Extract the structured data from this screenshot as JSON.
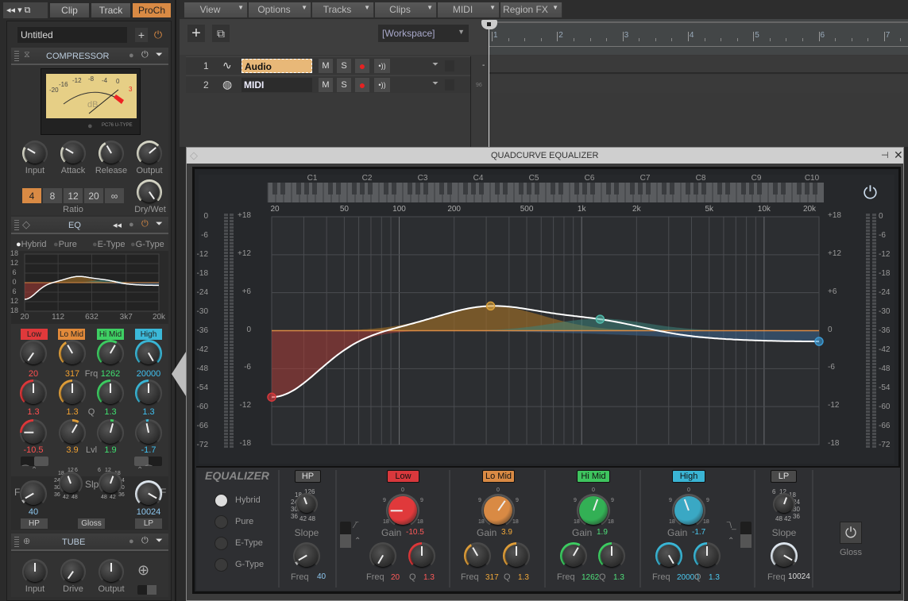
{
  "left_tabs": {
    "clip": "Clip",
    "track": "Track",
    "proch": "ProCh"
  },
  "prochannel": {
    "preset": "Untitled",
    "compressor": {
      "title": "COMPRESSOR",
      "vu_scale": [
        "-20",
        "-16",
        "-12",
        "-8",
        "-4",
        "0",
        "3"
      ],
      "vu_unit": "dB",
      "vu_brand": "PC76 U-TYPE",
      "knobs": [
        "Input",
        "Attack",
        "Release",
        "Output"
      ],
      "ratios": [
        "4",
        "8",
        "12",
        "20",
        "∞"
      ],
      "ratio_selected": "4",
      "ratio_label": "Ratio",
      "drywet_label": "Dry/Wet"
    },
    "eq": {
      "title": "EQ",
      "modes": [
        "Hybrid",
        "Pure",
        "E-Type",
        "G-Type"
      ],
      "selected_mode": "Hybrid",
      "mini_y_labels": [
        "18",
        "12",
        "6",
        "0",
        "6",
        "12",
        "18"
      ],
      "mini_x_labels": [
        "20",
        "112",
        "632",
        "3k7",
        "20k"
      ],
      "bands": [
        {
          "name": "Low",
          "freq": "20",
          "q": "1.3",
          "gain": "-10.5"
        },
        {
          "name": "Lo Mid",
          "freq": "317",
          "q": "1.3",
          "gain": "3.9"
        },
        {
          "name": "Hi Mid",
          "freq": "1262",
          "q": "1.3",
          "gain": "1.9"
        },
        {
          "name": "High",
          "freq": "20000",
          "q": "1.3",
          "gain": "-1.7"
        }
      ],
      "row_labels": {
        "freq": "Frq",
        "q": "Q",
        "lvl": "Lvl"
      },
      "slope_label": "Slp",
      "slope_ticks": [
        "6",
        "12",
        "18",
        "24",
        "30",
        "36",
        "42",
        "48"
      ],
      "filter_f_label": "F",
      "hp": {
        "label": "HP",
        "freq": "40"
      },
      "lp": {
        "label": "LP",
        "freq": "10024"
      },
      "gloss": "Gloss"
    },
    "tube": {
      "title": "TUBE",
      "knobs": [
        "Input",
        "Drive",
        "Output"
      ]
    }
  },
  "menu": [
    "View",
    "Options",
    "Tracks",
    "Clips",
    "MIDI",
    "Region FX"
  ],
  "workspace": "[Workspace]",
  "ruler": [
    "1",
    "2",
    "3",
    "4",
    "5",
    "6",
    "7"
  ],
  "tracks": [
    {
      "num": "1",
      "name": "Audio",
      "type": "audio",
      "selected": true
    },
    {
      "num": "2",
      "name": "MIDI",
      "type": "midi",
      "selected": false
    }
  ],
  "track_buttons": {
    "mute": "M",
    "solo": "S"
  },
  "track_meter": {
    "top": "-",
    "bottom": "96"
  },
  "quadcurve": {
    "title": "QUADCURVE EQUALIZER",
    "notes": [
      "C1",
      "C2",
      "C3",
      "C4",
      "C5",
      "C6",
      "C7",
      "C8",
      "C9",
      "C10"
    ],
    "freq_labels": [
      "20",
      "50",
      "100",
      "200",
      "500",
      "1k",
      "2k",
      "5k",
      "10k",
      "20k"
    ],
    "gain_labels": [
      "+18",
      "+12",
      "+6",
      "0",
      "-6",
      "-12",
      "-18"
    ],
    "meter_labels": [
      "0",
      "-6",
      "-12",
      "-18",
      "-24",
      "-30",
      "-36",
      "-42",
      "-48",
      "-54",
      "-60",
      "-66",
      "-72"
    ],
    "section_title": "EQUALIZER",
    "modes": [
      "Hybrid",
      "Pure",
      "E-Type",
      "G-Type"
    ],
    "selected_mode": "Hybrid",
    "hp": {
      "label": "HP",
      "slope_label": "Slope",
      "freq_label": "Freq",
      "freq": "40"
    },
    "lp": {
      "label": "LP",
      "slope_label": "Slope",
      "freq_label": "Freq",
      "freq": "10024"
    },
    "gain_scale": [
      "0",
      "9",
      "9",
      "18",
      "18"
    ],
    "labels": {
      "gain": "Gain",
      "freq": "Freq",
      "q": "Q"
    },
    "bands": [
      {
        "name": "Low",
        "gain": "-10.5",
        "freq": "20",
        "q": "1.3",
        "color": "#d8383c",
        "text_color": "#ff5a5a"
      },
      {
        "name": "Lo Mid",
        "gain": "3.9",
        "freq": "317",
        "q": "1.3",
        "color": "#d98a44",
        "text_color": "#f2a93a"
      },
      {
        "name": "Hi Mid",
        "gain": "1.9",
        "freq": "1262",
        "q": "1.3",
        "color": "#3ec45e",
        "text_color": "#4fe07a"
      },
      {
        "name": "High",
        "gain": "-1.7",
        "freq": "20000",
        "q": "1.3",
        "color": "#3ab4d4",
        "text_color": "#4cc8f0"
      }
    ],
    "gloss": "Gloss",
    "chart_data": {
      "type": "line",
      "xlabel": "",
      "ylabel": "",
      "x_scale": "log",
      "xlim": [
        20,
        20000
      ],
      "ylim": [
        -18,
        18
      ],
      "grid": true,
      "points": [
        {
          "band": "Low",
          "freq": 20,
          "gain": -10.5
        },
        {
          "band": "Lo Mid",
          "freq": 317,
          "gain": 3.9
        },
        {
          "band": "Hi Mid",
          "freq": 1262,
          "gain": 1.9
        },
        {
          "band": "High",
          "freq": 20000,
          "gain": -1.7
        }
      ]
    }
  }
}
